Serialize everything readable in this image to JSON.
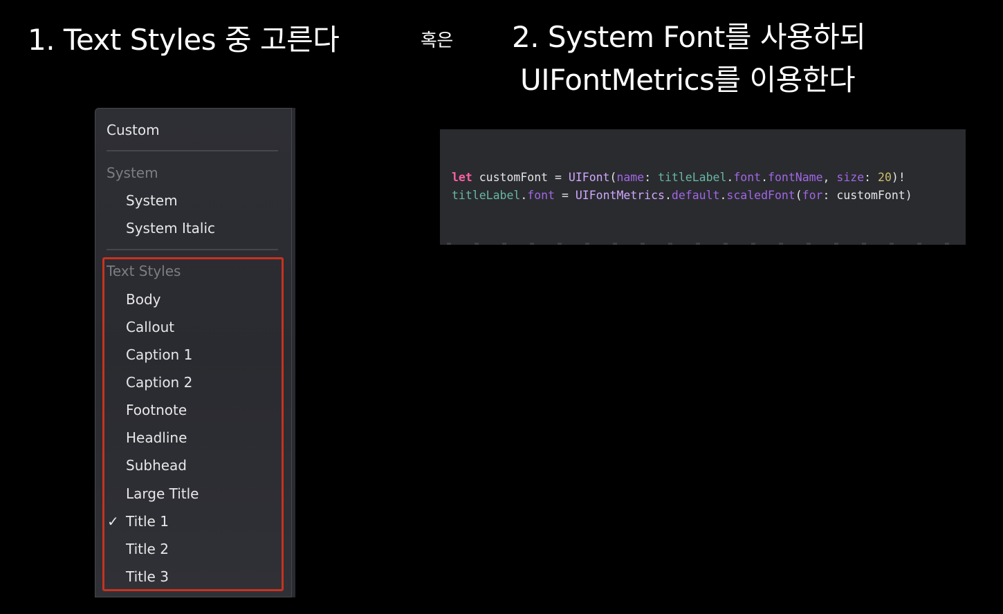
{
  "headings": {
    "option1": "1. Text Styles 중 고른다",
    "or": "혹은",
    "option2_line1": "2. System Font를 사용하되",
    "option2_line2": "UIFontMetrics를 이용한다"
  },
  "menu": {
    "custom": "Custom",
    "system_section": "System",
    "system_items": [
      "System",
      "System Italic"
    ],
    "text_styles_section": "Text Styles",
    "text_style_items": [
      "Body",
      "Callout",
      "Caption 1",
      "Caption 2",
      "Footnote",
      "Headline",
      "Subhead",
      "Large Title",
      "Title 1",
      "Title 2",
      "Title 3"
    ],
    "selected": "Title 1",
    "check_glyph": "✓"
  },
  "code": {
    "line1": {
      "kw_let": "let",
      "t1": " customFont = ",
      "type1": "UIFont",
      "t2": "(",
      "p_name": "name",
      "t3": ": ",
      "v1": "titleLabel",
      "t4": ".",
      "pr1": "font",
      "t5": ".",
      "pr2": "fontName",
      "t6": ", ",
      "p_size": "size",
      "t7": ": ",
      "num": "20",
      "t8": ")!"
    },
    "line2": {
      "v1": "titleLabel",
      "t1": ".",
      "pr1": "font",
      "t2": " = ",
      "type1": "UIFontMetrics",
      "t3": ".",
      "pr2": "default",
      "t4": ".",
      "pr3": "scaledFont",
      "t5": "(",
      "p_for": "for",
      "t6": ": customFont)"
    }
  },
  "colors": {
    "highlight": "#c8321f",
    "keyword": "#fc5fa3",
    "parameter": "#a167e6",
    "variable": "#67b7a4",
    "number": "#d0bf69",
    "background": "#000000"
  }
}
